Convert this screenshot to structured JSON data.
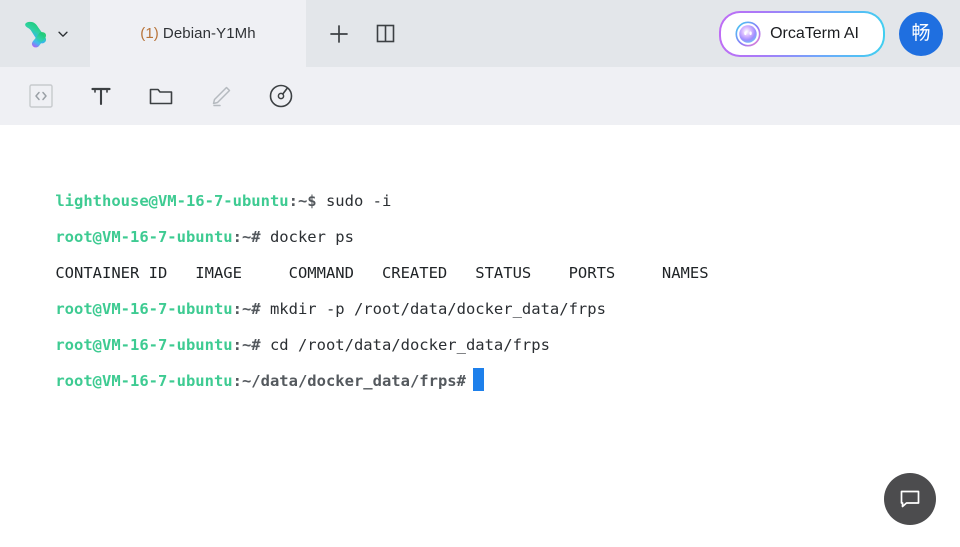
{
  "titlebar": {
    "logo_icon": "orcaterm-logo-icon",
    "logo_caret_icon": "chevron-down-icon",
    "tabs": [
      {
        "count": "(1)",
        "label": "Debian-Y1Mh",
        "active": true
      }
    ],
    "new_tab_icon": "plus-icon",
    "split_pane_icon": "split-pane-icon",
    "ai_button": {
      "label": "OrcaTerm AI",
      "icon": "ai-orb-icon",
      "border_gradient_from": "#c06cf5",
      "border_gradient_to": "#3fd0f0"
    },
    "avatar": {
      "label": "畅",
      "color": "#1f6fe0"
    }
  },
  "toolbar": {
    "items": [
      {
        "icon": "code-snippet-icon",
        "name": "code-snippet",
        "enabled": true,
        "boxed": true
      },
      {
        "icon": "text-format-icon",
        "name": "text-format",
        "enabled": true,
        "boxed": false
      },
      {
        "icon": "folder-icon",
        "name": "file-manager",
        "enabled": true,
        "boxed": false
      },
      {
        "icon": "pencil-icon",
        "name": "edit",
        "enabled": false,
        "boxed": false
      },
      {
        "icon": "gauge-icon",
        "name": "monitor",
        "enabled": true,
        "boxed": false
      }
    ]
  },
  "terminal": {
    "colors": {
      "host": "#3ecb92",
      "path": "#54595e",
      "text": "#2b2f33",
      "cursor": "#1e80eb",
      "background": "#ffffff"
    },
    "lines": [
      {
        "type": "prompt",
        "host": "lighthouse@VM-16-7-ubuntu",
        "path": ":~$",
        "command": " sudo -i"
      },
      {
        "type": "prompt",
        "host": "root@VM-16-7-ubuntu",
        "path": ":~#",
        "command": " docker ps"
      },
      {
        "type": "output",
        "text": "CONTAINER ID   IMAGE     COMMAND   CREATED   STATUS    PORTS     NAMES"
      },
      {
        "type": "prompt",
        "host": "root@VM-16-7-ubuntu",
        "path": ":~#",
        "command": " mkdir -p /root/data/docker_data/frps"
      },
      {
        "type": "prompt",
        "host": "root@VM-16-7-ubuntu",
        "path": ":~#",
        "command": " cd /root/data/docker_data/frps"
      },
      {
        "type": "prompt-cursor",
        "host": "root@VM-16-7-ubuntu",
        "path": ":~/data/docker_data/frps#",
        "command": ""
      }
    ]
  },
  "chat_fab": {
    "icon": "chat-bubble-icon",
    "color": "#4c4c4e"
  }
}
